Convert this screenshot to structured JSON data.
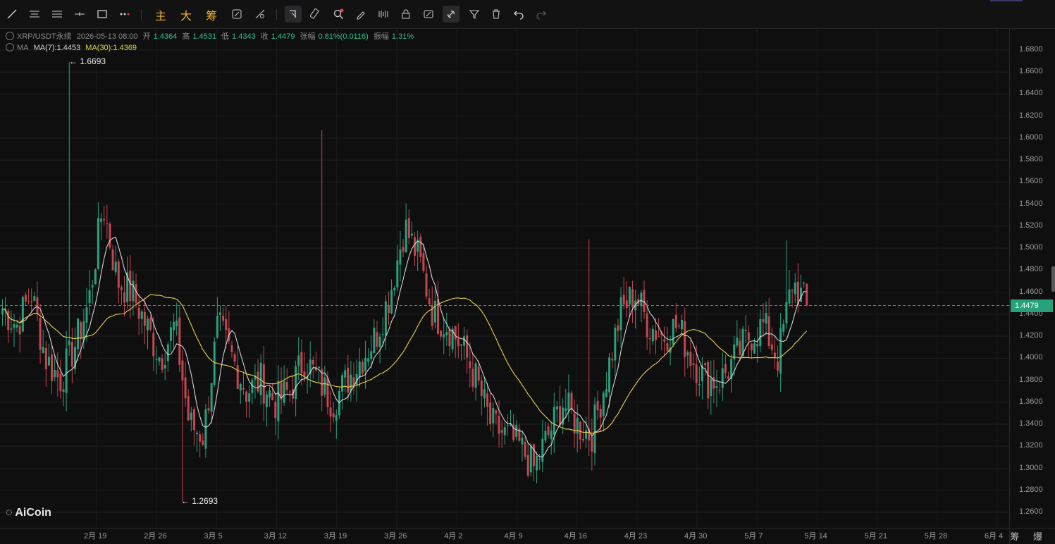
{
  "toolbar": {
    "text_buttons": [
      "主",
      "大",
      "筹"
    ],
    "icons": [
      "trend-line-icon",
      "horizontal-lines-icon",
      "parallel-lines-icon",
      "ray-line-icon",
      "rectangle-icon",
      "more-tools-icon",
      "text-annotation-icon",
      "measure-icon",
      "magnet-icon",
      "zoom-icon",
      "brush-icon",
      "pattern-icon",
      "lock-icon",
      "show-hide-icon",
      "link-icon",
      "filter-icon",
      "trash-icon",
      "undo-icon",
      "redo-icon"
    ]
  },
  "info": {
    "symbol": "XRP/USDT永续",
    "datetime": "2026-05-13 08:00",
    "open_label": "开",
    "open": "1.4364",
    "high_label": "高",
    "high": "1.4531",
    "low_label": "低",
    "low": "1.4343",
    "close_label": "收",
    "close": "1.4479",
    "change_label": "张幅",
    "change": "0.81%(0.0116)",
    "amp_label": "振幅",
    "amp": "1.31%",
    "ma_label": "MA",
    "ma7": "MA(7):1.4453",
    "ma30": "MA(30):1.4369"
  },
  "current_price": "1.4479",
  "high_marker": "← 1.6693",
  "low_marker": "← 1.2693",
  "logo_text": "AiCoin",
  "bottom_right_text": "筹 爆",
  "colors": {
    "up": "#26a17b",
    "down": "#c5464f",
    "ma7": "#e8e8e8",
    "ma30": "#e6d34a",
    "background": "#0f0f10"
  },
  "chart_data": {
    "type": "candlestick",
    "title": "",
    "ylim": [
      1.25,
      1.69
    ],
    "y_ticks": [
      "1.6800",
      "1.6600",
      "1.6400",
      "1.6200",
      "1.6000",
      "1.5800",
      "1.5600",
      "1.5400",
      "1.5200",
      "1.5000",
      "1.4800",
      "1.4600",
      "1.4400",
      "1.4200",
      "1.4000",
      "1.3800",
      "1.3600",
      "1.3400",
      "1.3200",
      "1.3000",
      "1.2800",
      "1.2600"
    ],
    "x_ticks": [
      "2月 19",
      "2月 26",
      "3月 5",
      "3月 12",
      "3月 19",
      "3月 26",
      "4月 2",
      "4月 9",
      "4月 16",
      "4月 23",
      "4月 30",
      "5月 7",
      "5月 14",
      "5月 21",
      "5月 28",
      "6月 4"
    ],
    "price_anchors": [
      1.445,
      1.43,
      1.46,
      1.4,
      1.38,
      1.41,
      1.45,
      1.54,
      1.47,
      1.46,
      1.43,
      1.4,
      1.43,
      1.34,
      1.33,
      1.43,
      1.4,
      1.37,
      1.38,
      1.36,
      1.37,
      1.4,
      1.38,
      1.36,
      1.38,
      1.4,
      1.42,
      1.46,
      1.52,
      1.49,
      1.44,
      1.43,
      1.41,
      1.38,
      1.34,
      1.33,
      1.32,
      1.3,
      1.33,
      1.36,
      1.34,
      1.33,
      1.38,
      1.44,
      1.46,
      1.43,
      1.42,
      1.43,
      1.4,
      1.38,
      1.38,
      1.4,
      1.42,
      1.43,
      1.4,
      1.47,
      1.4479
    ],
    "high": 1.6693,
    "low": 1.2693,
    "last": 1.4479,
    "series": [
      {
        "name": "MA(7)",
        "last": 1.4453
      },
      {
        "name": "MA(30)",
        "last": 1.4369
      }
    ]
  }
}
